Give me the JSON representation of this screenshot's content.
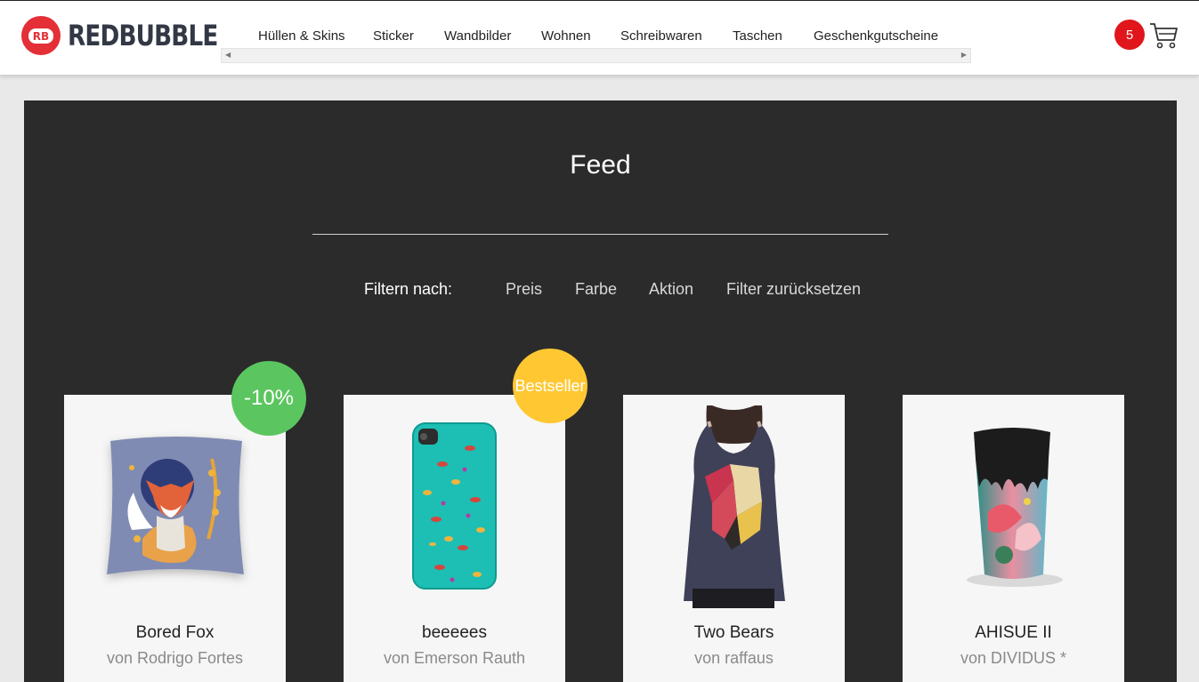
{
  "brand": {
    "name": "REDBUBBLE",
    "badge_text": "RB",
    "accent": "#e42f37"
  },
  "nav": {
    "items": [
      {
        "label": "Hüllen & Skins"
      },
      {
        "label": "Sticker"
      },
      {
        "label": "Wandbilder"
      },
      {
        "label": "Wohnen"
      },
      {
        "label": "Schreibwaren"
      },
      {
        "label": "Taschen"
      },
      {
        "label": "Geschenkgutscheine"
      }
    ]
  },
  "cart": {
    "count": "5",
    "icon": "cart-icon",
    "badge_color": "#e0161c"
  },
  "feed": {
    "title": "Feed",
    "filter_label": "Filtern nach:",
    "filters": [
      {
        "label": "Preis"
      },
      {
        "label": "Farbe"
      },
      {
        "label": "Aktion"
      },
      {
        "label": "Filter zurücksetzen"
      }
    ]
  },
  "products": [
    {
      "title": "Bored Fox",
      "author": "von Rodrigo Fortes",
      "badge": "-10%",
      "badge_color": "#5bc65f"
    },
    {
      "title": "beeeees",
      "author": "von Emerson Rauth",
      "badge": "Bestseller",
      "badge_color": "#ffc833"
    },
    {
      "title": "Two Bears",
      "author": "von raffaus"
    },
    {
      "title": "AHISUE II",
      "author": "von DIVIDUS *"
    }
  ]
}
